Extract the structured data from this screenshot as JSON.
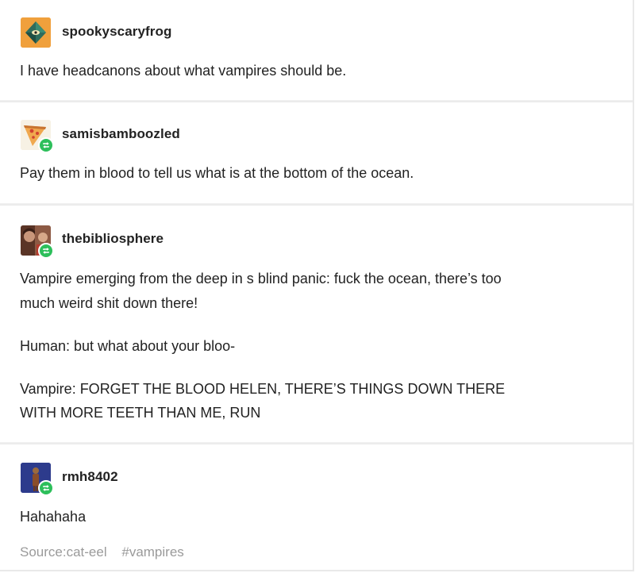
{
  "posts": [
    {
      "username": "spookyscaryfrog",
      "avatar": "pyramid-eye-icon",
      "lines": [
        "I have headcanons about what vampires should be."
      ]
    },
    {
      "username": "samisbamboozled",
      "avatar": "pizza-slice-icon",
      "lines": [
        "Pay them in blood to tell us what is at the bottom of the ocean."
      ]
    },
    {
      "username": "thebibliosphere",
      "avatar": "photo-avatar",
      "paragraphs": [
        [
          "Vampire emerging from the deep in s blind panic: fuck the ocean, there’s too",
          "much weird shit down there!"
        ],
        [
          "Human: but what about your bloo-"
        ],
        [
          "Vampire: FORGET THE BLOOD HELEN, THERE’S THINGS DOWN THERE",
          "WITH MORE TEETH THAN ME, RUN"
        ]
      ]
    },
    {
      "username": "rmh8402",
      "avatar": "figure-avatar",
      "lines": [
        "Hahahaha"
      ]
    }
  ],
  "footer": {
    "source": "Source:cat-eel",
    "tag": "#vampires"
  },
  "colors": {
    "reblog": "#2dbf5b",
    "text": "#222222",
    "muted": "#9a9a9a"
  }
}
